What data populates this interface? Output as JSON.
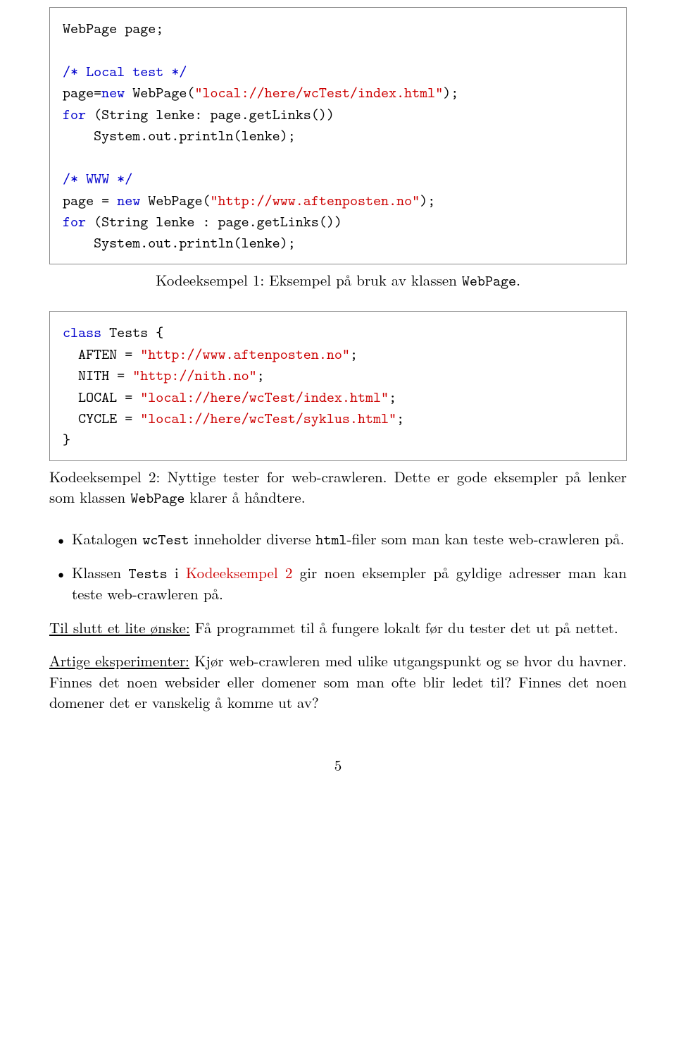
{
  "code1": {
    "l1a": "WebPage page;",
    "l2a": "/* Local test */",
    "l3a": "page=",
    "l3b": "new",
    "l3c": " WebPage(",
    "l3d": "\"local://here/wcTest/index.html\"",
    "l3e": ");",
    "l4a": "for",
    "l4b": " (String lenke: page.getLinks())",
    "l5a": "    System.out.println(lenke);",
    "l6a": "/* WWW */",
    "l7a": "page = ",
    "l7b": "new",
    "l7c": " WebPage(",
    "l7d": "\"http://www.aftenposten.no\"",
    "l7e": ");",
    "l8a": "for",
    "l8b": " (String lenke : page.getLinks())",
    "l9a": "    System.out.println(lenke);"
  },
  "caption1": {
    "pre": "Kodeeksempel 1: Eksempel på bruk av klassen ",
    "code": "WebPage",
    "post": "."
  },
  "code2": {
    "l1a": "class",
    "l1b": " Tests {",
    "l2a": "  AFTEN = ",
    "l2b": "\"http://www.aftenposten.no\"",
    "l2c": ";",
    "l3a": "  NITH = ",
    "l3b": "\"http://nith.no\"",
    "l3c": ";",
    "l4a": "  LOCAL = ",
    "l4b": "\"local://here/wcTest/index.html\"",
    "l4c": ";",
    "l5a": "  CYCLE = ",
    "l5b": "\"local://here/wcTest/syklus.html\"",
    "l5c": ";",
    "l6a": "}"
  },
  "caption2": {
    "pre": "Kodeeksempel 2: Nyttige tester for web-crawleren. Dette er gode eksempler på lenker som klassen ",
    "code": "WebPage",
    "post": " klarer å håndtere."
  },
  "bullet1": {
    "t1": "Katalogen ",
    "c1": "wcTest",
    "t2": " inneholder diverse ",
    "c2": "html",
    "t3": "-filer som man kan teste web-crawleren på."
  },
  "bullet2": {
    "t1": "Klassen ",
    "c1": "Tests",
    "t2": " i ",
    "ref": "Kodeeksempel 2",
    "t3": " gir noen eksempler på gyldige adresser man kan teste web-crawleren på."
  },
  "p1": {
    "u": "Til slutt et lite ønske:",
    "t": " Få programmet til å fungere lokalt før du tester det ut på nettet."
  },
  "p2": {
    "u": "Artige eksperimenter:",
    "t": " Kjør web-crawleren med ulike utgangspunkt og se hvor du havner. Finnes det noen websider eller domener som man ofte blir ledet til? Finnes det noen domener det er vanskelig å komme ut av?"
  },
  "pagenum": "5"
}
